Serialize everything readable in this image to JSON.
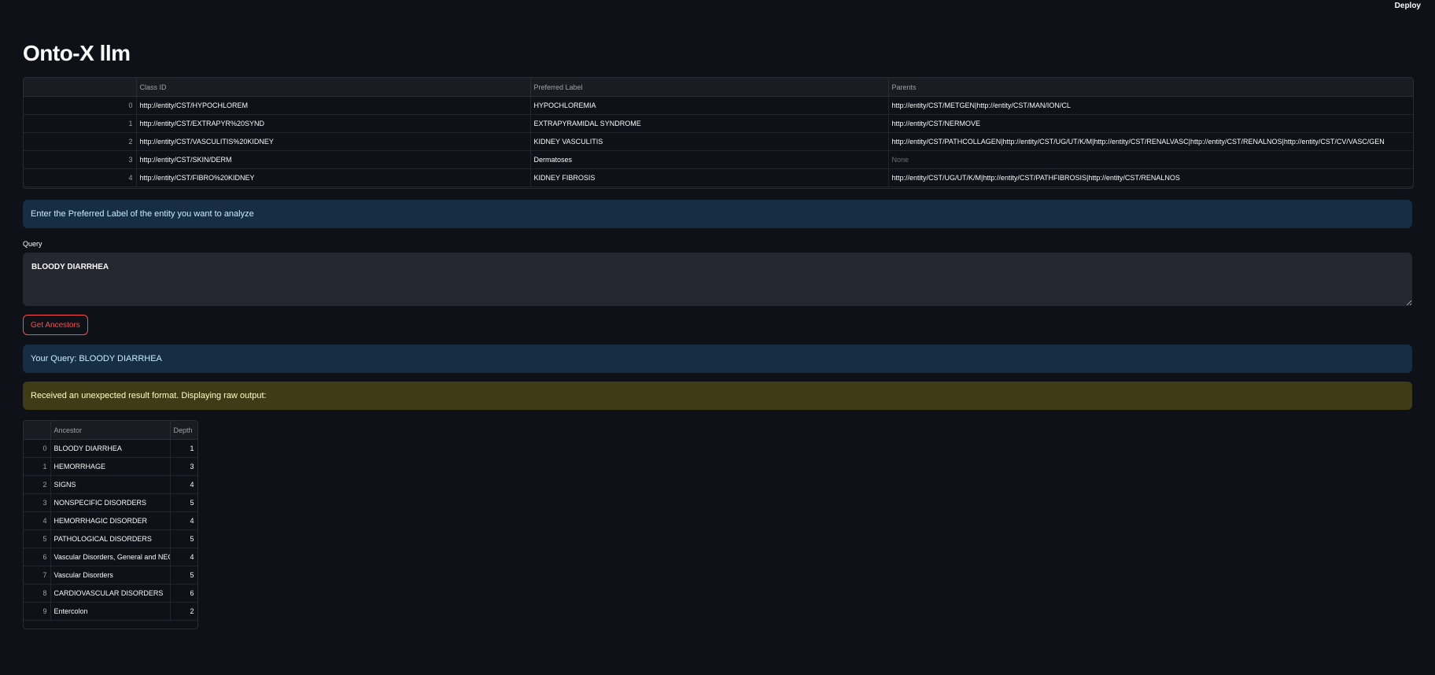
{
  "topbar": {
    "deploy_label": "Deploy"
  },
  "title": "Onto-X llm",
  "entity_table": {
    "columns": [
      "",
      "Class ID",
      "Preferred Label",
      "Parents"
    ],
    "rows": [
      {
        "index": "0",
        "class_id": "http://entity/CST/HYPOCHLOREM",
        "label": "HYPOCHLOREMIA",
        "parents": "http://entity/CST/METGEN|http://entity/CST/MAN/ION/CL"
      },
      {
        "index": "1",
        "class_id": "http://entity/CST/EXTRAPYR%20SYND",
        "label": "EXTRAPYRAMIDAL SYNDROME",
        "parents": "http://entity/CST/NERMOVE"
      },
      {
        "index": "2",
        "class_id": "http://entity/CST/VASCULITIS%20KIDNEY",
        "label": "KIDNEY VASCULITIS",
        "parents": "http://entity/CST/PATHCOLLAGEN|http://entity/CST/UG/UT/K/M|http://entity/CST/RENALVASC|http://entity/CST/RENALNOS|http://entity/CST/CV/VASC/GEN"
      },
      {
        "index": "3",
        "class_id": "http://entity/CST/SKIN/DERM",
        "label": "Dermatoses",
        "parents": "None"
      },
      {
        "index": "4",
        "class_id": "http://entity/CST/FIBRO%20KIDNEY",
        "label": "KIDNEY FIBROSIS",
        "parents": "http://entity/CST/UG/UT/K/M|http://entity/CST/PATHFIBROSIS|http://entity/CST/RENALNOS"
      }
    ]
  },
  "instruction": "Enter the Preferred Label of the entity you want to analyze",
  "query": {
    "label": "Query",
    "value": "BLOODY DIARRHEA"
  },
  "button": {
    "label": "Get Ancestors"
  },
  "your_query": "Your Query: BLOODY DIARRHEA",
  "warning": "Received an unexpected result format. Displaying raw output:",
  "ancestor_table": {
    "columns": [
      "",
      "Ancestor",
      "Depth"
    ],
    "rows": [
      {
        "index": "0",
        "ancestor": "BLOODY DIARRHEA",
        "depth": "1"
      },
      {
        "index": "1",
        "ancestor": "HEMORRHAGE",
        "depth": "3"
      },
      {
        "index": "2",
        "ancestor": "SIGNS",
        "depth": "4"
      },
      {
        "index": "3",
        "ancestor": "NONSPECIFIC DISORDERS",
        "depth": "5"
      },
      {
        "index": "4",
        "ancestor": "HEMORRHAGIC DISORDER",
        "depth": "4"
      },
      {
        "index": "5",
        "ancestor": "PATHOLOGICAL DISORDERS",
        "depth": "5"
      },
      {
        "index": "6",
        "ancestor": "Vascular Disorders, General and NEC",
        "depth": "4"
      },
      {
        "index": "7",
        "ancestor": "Vascular Disorders",
        "depth": "5"
      },
      {
        "index": "8",
        "ancestor": "CARDIOVASCULAR DISORDERS",
        "depth": "6"
      },
      {
        "index": "9",
        "ancestor": "Entercolon",
        "depth": "2"
      }
    ]
  }
}
